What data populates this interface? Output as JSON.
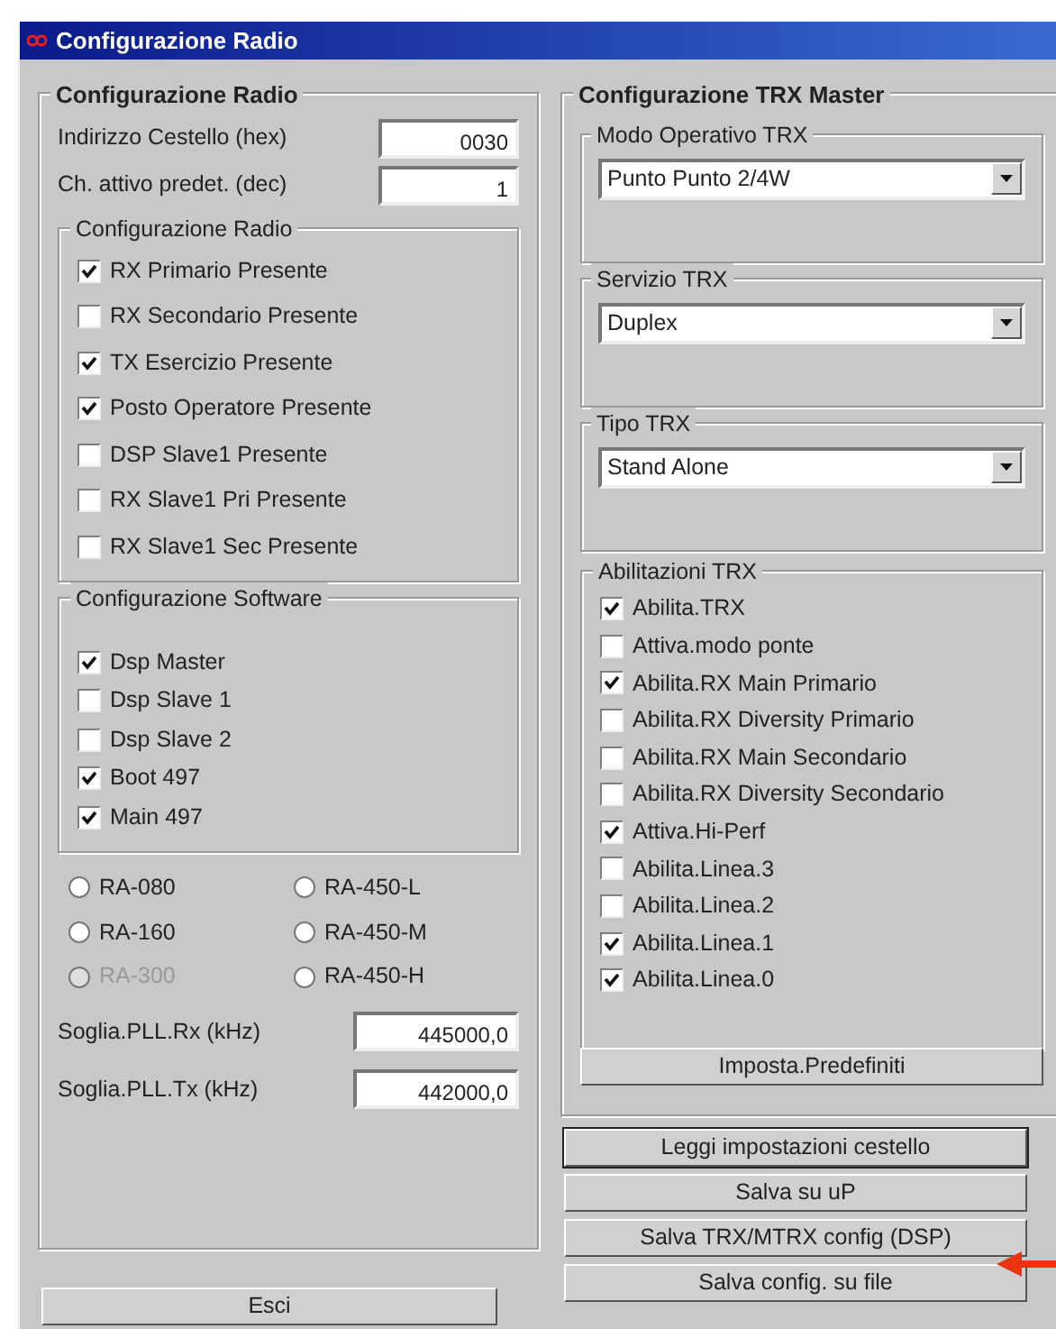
{
  "window": {
    "title": "Configurazione Radio"
  },
  "left": {
    "title": "Configurazione Radio",
    "fields": [
      {
        "label": "Indirizzo Cestello (hex)",
        "value": "0030"
      },
      {
        "label": "Ch. attivo predet. (dec)",
        "value": "1"
      }
    ],
    "radio_config": {
      "title": "Configurazione Radio",
      "options": [
        {
          "label": "RX Primario Presente",
          "checked": true
        },
        {
          "label": "RX Secondario Presente",
          "checked": false
        },
        {
          "label": "TX Esercizio Presente",
          "checked": true
        },
        {
          "label": "Posto Operatore Presente",
          "checked": true
        },
        {
          "label": "DSP Slave1 Presente",
          "checked": false
        },
        {
          "label": "RX Slave1 Pri Presente",
          "checked": false
        },
        {
          "label": "RX Slave1 Sec Presente",
          "checked": false
        }
      ]
    },
    "software_config": {
      "title": "Configurazione Software",
      "options": [
        {
          "label": "Dsp Master",
          "checked": true
        },
        {
          "label": "Dsp Slave 1",
          "checked": false
        },
        {
          "label": "Dsp Slave 2",
          "checked": false
        },
        {
          "label": "Boot 497",
          "checked": true
        },
        {
          "label": "Main 497",
          "checked": true
        }
      ]
    },
    "models": [
      {
        "label": "RA-080",
        "selected": false,
        "disabled": false
      },
      {
        "label": "RA-450-L",
        "selected": false,
        "disabled": false
      },
      {
        "label": "RA-160",
        "selected": false,
        "disabled": false
      },
      {
        "label": "RA-450-M",
        "selected": false,
        "disabled": false
      },
      {
        "label": "RA-300",
        "selected": false,
        "disabled": true
      },
      {
        "label": "RA-450-H",
        "selected": false,
        "disabled": false
      }
    ],
    "pll": [
      {
        "label": "Soglia.PLL.Rx (kHz)",
        "value": "445000,0"
      },
      {
        "label": "Soglia.PLL.Tx (kHz)",
        "value": "442000,0"
      }
    ]
  },
  "exit_button": "Esci",
  "right": {
    "title": "Configurazione TRX Master",
    "selects": [
      {
        "title": "Modo Operativo TRX",
        "value": "Punto Punto 2/4W"
      },
      {
        "title": "Servizio TRX",
        "value": "Duplex"
      },
      {
        "title": "Tipo TRX",
        "value": "Stand Alone"
      }
    ],
    "enables": {
      "title": "Abilitazioni TRX",
      "options": [
        {
          "label": "Abilita.TRX",
          "checked": true
        },
        {
          "label": "Attiva.modo ponte",
          "checked": false
        },
        {
          "label": "Abilita.RX Main Primario",
          "checked": true
        },
        {
          "label": "Abilita.RX Diversity Primario",
          "checked": false
        },
        {
          "label": "Abilita.RX Main Secondario",
          "checked": false
        },
        {
          "label": "Abilita.RX Diversity Secondario",
          "checked": false
        },
        {
          "label": "Attiva.Hi-Perf",
          "checked": true
        },
        {
          "label": "Abilita.Linea.3",
          "checked": false
        },
        {
          "label": "Abilita.Linea.2",
          "checked": false
        },
        {
          "label": "Abilita.Linea.1",
          "checked": true
        },
        {
          "label": "Abilita.Linea.0",
          "checked": true
        }
      ]
    },
    "defaults_button": "Imposta.Predefiniti"
  },
  "buttons": [
    {
      "label": "Leggi impostazioni cestello",
      "selected": true
    },
    {
      "label": "Salva su uP",
      "selected": false
    },
    {
      "label": "Salva TRX/MTRX config (DSP)",
      "selected": false
    },
    {
      "label": "Salva config. su file",
      "selected": false
    }
  ]
}
